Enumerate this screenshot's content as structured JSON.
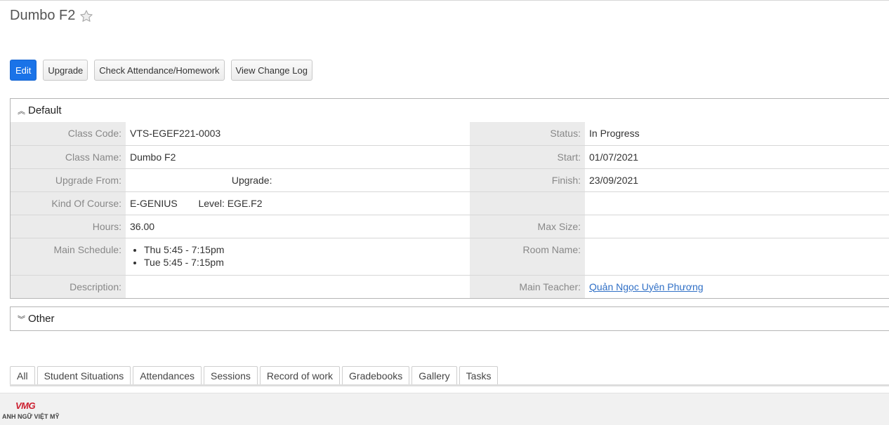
{
  "header": {
    "title": "Dumbo F2"
  },
  "toolbar": {
    "edit": "Edit",
    "upgrade": "Upgrade",
    "check_attendance": "Check Attendance/Homework",
    "view_change_log": "View Change Log"
  },
  "default_panel": {
    "title": "Default",
    "class_code_label": "Class Code:",
    "class_code": "VTS-EGEF221-0003",
    "status_label": "Status:",
    "status": "In Progress",
    "class_name_label": "Class Name:",
    "class_name": "Dumbo F2",
    "start_label": "Start:",
    "start": "01/07/2021",
    "upgrade_from_label": "Upgrade From:",
    "upgrade_from": "",
    "upgrade_label": "Upgrade:",
    "upgrade": "",
    "finish_label": "Finish:",
    "finish": "23/09/2021",
    "kind_label": "Kind Of Course:",
    "kind": "E-GENIUS",
    "level_label": "Level:",
    "level": "EGE.F2",
    "hours_label": "Hours:",
    "hours": "36.00",
    "max_size_label": "Max Size:",
    "max_size": "",
    "schedule_label": "Main Schedule:",
    "schedule": [
      "Thu 5:45 - 7:15pm",
      "Tue 5:45 - 7:15pm"
    ],
    "room_label": "Room Name:",
    "room": "",
    "description_label": "Description:",
    "description": "",
    "teacher_label": "Main Teacher:",
    "teacher": "Quản Ngọc Uyên Phương"
  },
  "other_panel": {
    "title": "Other"
  },
  "tabs": [
    "All",
    "Student Situations",
    "Attendances",
    "Sessions",
    "Record of work",
    "Gradebooks",
    "Gallery",
    "Tasks"
  ],
  "footer": {
    "logo_mark": "VMG",
    "logo_text": "ANH NGỮ VIỆT MỸ"
  },
  "colors": {
    "primary": "#1a73e8",
    "label_bg": "#ebebeb",
    "link": "#2f6fc6",
    "brand_red": "#cc1f2f"
  }
}
